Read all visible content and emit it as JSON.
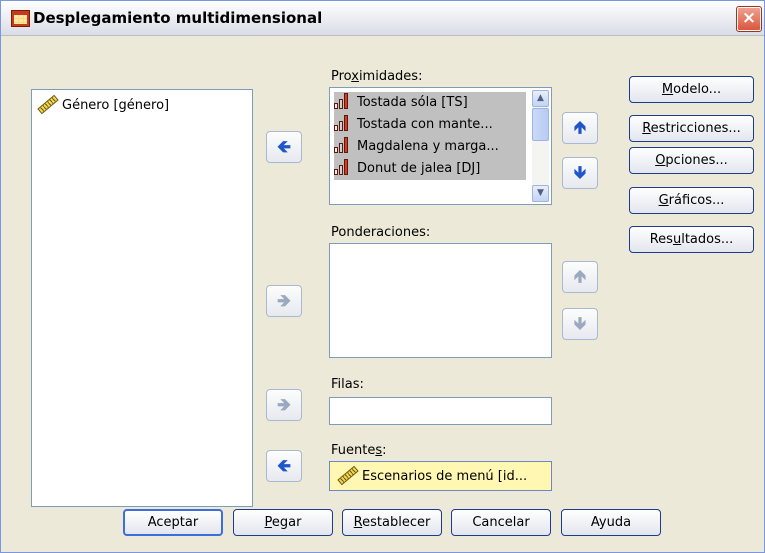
{
  "window": {
    "title": "Desplegamiento multidimensional",
    "close_glyph": "×"
  },
  "variables": {
    "items": [
      {
        "label": "Género [género]",
        "icon": "ruler-icon"
      }
    ]
  },
  "proximidades": {
    "label_pre": "Pro",
    "label_u": "x",
    "label_post": "imidades:",
    "items": [
      {
        "label": "Tostada sóla [TS]",
        "icon": "bar-chart-icon"
      },
      {
        "label": "Tostada con mante...",
        "icon": "bar-chart-icon"
      },
      {
        "label": "Magdalena y marga...",
        "icon": "bar-chart-icon"
      },
      {
        "label": "Donut de jalea [DJ]",
        "icon": "bar-chart-icon"
      }
    ]
  },
  "ponderaciones": {
    "label": "Ponderaciones:"
  },
  "filas": {
    "label": "Filas:"
  },
  "fuentes": {
    "label_pre": "Fuente",
    "label_u": "s",
    "label_post": ":",
    "items": [
      {
        "label": "Escenarios de menú [id...",
        "icon": "ruler-icon"
      }
    ]
  },
  "arrows": {
    "left": "🡸",
    "right": "🡺",
    "up": "🡹",
    "down": "🡻"
  },
  "side_buttons": {
    "modelo": {
      "pre": "",
      "u": "M",
      "post": "odelo..."
    },
    "restricciones": {
      "pre": "",
      "u": "R",
      "post": "estricciones..."
    },
    "opciones": {
      "pre": "",
      "u": "O",
      "post": "pciones..."
    },
    "graficos": {
      "pre": "",
      "u": "G",
      "post": "ráficos..."
    },
    "resultados": {
      "pre": "Res",
      "u": "u",
      "post": "ltados..."
    }
  },
  "bottom_buttons": {
    "aceptar": "Aceptar",
    "pegar": {
      "pre": "",
      "u": "P",
      "post": "egar"
    },
    "restablecer": {
      "pre": "",
      "u": "R",
      "post": "establecer"
    },
    "cancelar": "Cancelar",
    "ayuda": "Ayuda"
  },
  "colors": {
    "dialog_bg": "#ece9d8",
    "selection_bg": "#c0c0c0",
    "highlight_bg": "#fff7b2",
    "accent_blue": "#1f56c9"
  }
}
